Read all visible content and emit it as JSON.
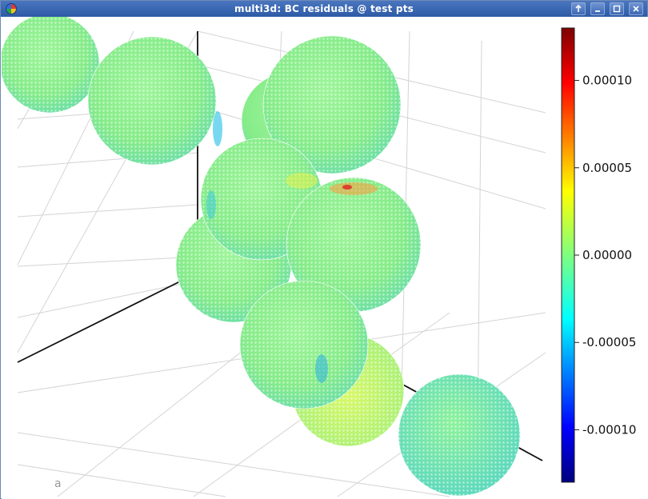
{
  "window": {
    "title": "multi3d: BC residuals @ test pts",
    "buttons": [
      "arrow-up-icon",
      "minimize-icon",
      "maximize-icon",
      "close-icon"
    ]
  },
  "plot": {
    "type": "3d-scatter",
    "grid": true,
    "colormap": "jet",
    "colorbar": {
      "position": "right",
      "ticks": [
        "0.00010",
        "0.00005",
        "0.00000",
        "-0.00005",
        "-0.00010"
      ],
      "tick_values": [
        0.0001,
        5e-05,
        0.0,
        -5e-05,
        -0.0001
      ],
      "range": [
        -0.00013,
        0.00013
      ]
    },
    "stray_axis_text": "a"
  }
}
